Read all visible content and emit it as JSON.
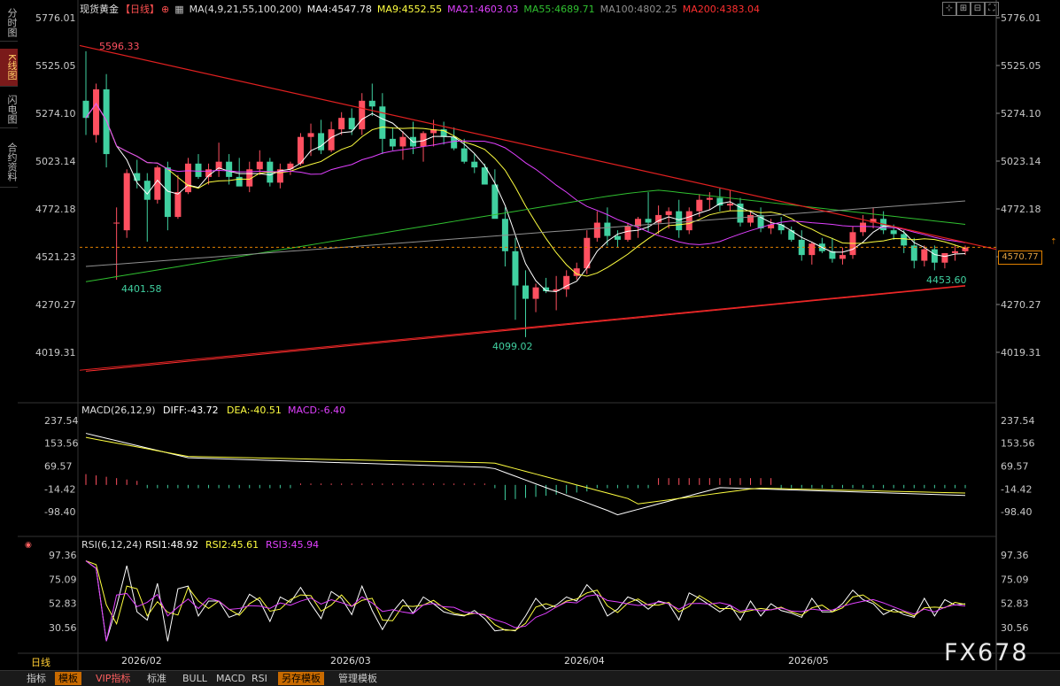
{
  "side_tabs": [
    "分时图",
    "K线图",
    "闪电图",
    "合约资料"
  ],
  "header": {
    "title": "现货黄金",
    "period": "【日线】",
    "add_icon": "⊕",
    "ma_params": "MA(4,9,21,55,100,200)",
    "ma4": "MA4:4547.78",
    "ma9": "MA9:4552.55",
    "ma21": "MA21:4603.03",
    "ma55": "MA55:4689.71",
    "ma100": "MA100:4802.25",
    "ma200": "MA200:4383.04"
  },
  "colors": {
    "up": "#ff5060",
    "down": "#40d0a0",
    "ma4": "#ffffff",
    "ma9": "#ffff40",
    "ma21": "#e040ff",
    "ma55": "#30c030",
    "ma100": "#909090",
    "ma200": "#ff3030",
    "axis": "#c8c8c8",
    "trend": "#e02020"
  },
  "price_axis": [
    "5776.01",
    "5525.05",
    "5274.10",
    "5023.14",
    "4772.18",
    "4521.23",
    "4270.27",
    "4019.31"
  ],
  "current_price": "4570.77",
  "annotations": {
    "high": "5596.33",
    "low1": "4401.58",
    "low2": "4099.02",
    "low3": "4453.60"
  },
  "macd": {
    "title": "MACD(26,12,9)",
    "diff": "DIFF:-43.72",
    "dea": "DEA:-40.51",
    "macd": "MACD:-6.40",
    "axis": [
      "237.54",
      "153.56",
      "69.57",
      "-14.42",
      "-98.40"
    ]
  },
  "rsi": {
    "title": "RSI(6,12,24)",
    "rsi1": "RSI1:48.92",
    "rsi2": "RSI2:45.61",
    "rsi3": "RSI3:45.94",
    "axis": [
      "97.36",
      "75.09",
      "52.83",
      "30.56"
    ]
  },
  "dates": [
    "2026/02",
    "2026/03",
    "2026/04",
    "2026/05"
  ],
  "period_label": "日线",
  "bottom_tabs": [
    "指标",
    "模板",
    "VIP指标",
    "标准",
    "BULL",
    "MACD",
    "RSI",
    "另存模板",
    "管理模板"
  ],
  "watermark": "FX678",
  "chart_data": {
    "type": "candlestick",
    "candles": [
      [
        5340,
        5600,
        5160,
        5250
      ],
      [
        5160,
        5430,
        5120,
        5400
      ],
      [
        5400,
        5480,
        4990,
        5060
      ],
      [
        4700,
        4780,
        4400,
        4700
      ],
      [
        4660,
        4980,
        4620,
        4960
      ],
      [
        4960,
        5030,
        4880,
        4920
      ],
      [
        4920,
        4960,
        4600,
        4820
      ],
      [
        4820,
        5000,
        4800,
        4990
      ],
      [
        4990,
        5020,
        4660,
        4730
      ],
      [
        4730,
        4950,
        4720,
        4860
      ],
      [
        4860,
        5040,
        4850,
        5010
      ],
      [
        5010,
        5060,
        4930,
        4940
      ],
      [
        4940,
        5010,
        4900,
        4980
      ],
      [
        4980,
        5120,
        4940,
        5020
      ],
      [
        5020,
        5060,
        4900,
        4940
      ],
      [
        4940,
        5040,
        4900,
        4890
      ],
      [
        4890,
        5020,
        4860,
        4980
      ],
      [
        4980,
        5080,
        4950,
        5020
      ],
      [
        5020,
        5040,
        4890,
        4910
      ],
      [
        4910,
        5010,
        4880,
        4980
      ],
      [
        4980,
        5020,
        4950,
        5010
      ],
      [
        5010,
        5170,
        5000,
        5150
      ],
      [
        5150,
        5220,
        5050,
        5170
      ],
      [
        5170,
        5240,
        5060,
        5080
      ],
      [
        5080,
        5230,
        5070,
        5190
      ],
      [
        5190,
        5280,
        5160,
        5250
      ],
      [
        5250,
        5300,
        5160,
        5190
      ],
      [
        5190,
        5380,
        5160,
        5340
      ],
      [
        5340,
        5430,
        5260,
        5310
      ],
      [
        5310,
        5380,
        5060,
        5140
      ],
      [
        5140,
        5200,
        5080,
        5100
      ],
      [
        5100,
        5180,
        5030,
        5150
      ],
      [
        5150,
        5230,
        5060,
        5100
      ],
      [
        5100,
        5180,
        5020,
        5170
      ],
      [
        5170,
        5240,
        5100,
        5190
      ],
      [
        5190,
        5230,
        5110,
        5150
      ],
      [
        5150,
        5200,
        5080,
        5090
      ],
      [
        5090,
        5140,
        5010,
        5020
      ],
      [
        5020,
        5060,
        4960,
        4990
      ],
      [
        4990,
        5010,
        4900,
        4900
      ],
      [
        4900,
        4980,
        4770,
        4720
      ],
      [
        4720,
        4780,
        4470,
        4550
      ],
      [
        4550,
        4620,
        4190,
        4370
      ],
      [
        4370,
        4450,
        4099,
        4300
      ],
      [
        4300,
        4380,
        4230,
        4360
      ],
      [
        4360,
        4410,
        4330,
        4340
      ],
      [
        4340,
        4420,
        4240,
        4350
      ],
      [
        4350,
        4450,
        4310,
        4420
      ],
      [
        4420,
        4490,
        4400,
        4460
      ],
      [
        4460,
        4660,
        4430,
        4620
      ],
      [
        4620,
        4760,
        4600,
        4700
      ],
      [
        4700,
        4780,
        4580,
        4630
      ],
      [
        4630,
        4660,
        4570,
        4610
      ],
      [
        4610,
        4700,
        4600,
        4680
      ],
      [
        4680,
        4730,
        4620,
        4720
      ],
      [
        4720,
        4860,
        4650,
        4700
      ],
      [
        4700,
        4790,
        4640,
        4740
      ],
      [
        4740,
        4780,
        4670,
        4760
      ],
      [
        4760,
        4820,
        4620,
        4660
      ],
      [
        4660,
        4780,
        4640,
        4760
      ],
      [
        4760,
        4850,
        4730,
        4820
      ],
      [
        4820,
        4860,
        4770,
        4830
      ],
      [
        4830,
        4880,
        4760,
        4790
      ],
      [
        4790,
        4870,
        4760,
        4800
      ],
      [
        4800,
        4830,
        4680,
        4700
      ],
      [
        4700,
        4760,
        4680,
        4740
      ],
      [
        4740,
        4780,
        4650,
        4670
      ],
      [
        4670,
        4720,
        4640,
        4690
      ],
      [
        4690,
        4730,
        4640,
        4660
      ],
      [
        4660,
        4680,
        4600,
        4610
      ],
      [
        4610,
        4660,
        4500,
        4530
      ],
      [
        4530,
        4600,
        4480,
        4590
      ],
      [
        4590,
        4620,
        4540,
        4550
      ],
      [
        4550,
        4620,
        4490,
        4510
      ],
      [
        4510,
        4570,
        4480,
        4530
      ],
      [
        4530,
        4680,
        4510,
        4650
      ],
      [
        4650,
        4740,
        4630,
        4700
      ],
      [
        4700,
        4780,
        4670,
        4720
      ],
      [
        4720,
        4760,
        4640,
        4660
      ],
      [
        4660,
        4690,
        4610,
        4640
      ],
      [
        4640,
        4660,
        4540,
        4580
      ],
      [
        4580,
        4620,
        4460,
        4500
      ],
      [
        4500,
        4580,
        4470,
        4560
      ],
      [
        4560,
        4580,
        4450,
        4490
      ],
      [
        4490,
        4540,
        4460,
        4540
      ],
      [
        4540,
        4580,
        4500,
        4550
      ],
      [
        4550,
        4580,
        4530,
        4570
      ]
    ]
  }
}
